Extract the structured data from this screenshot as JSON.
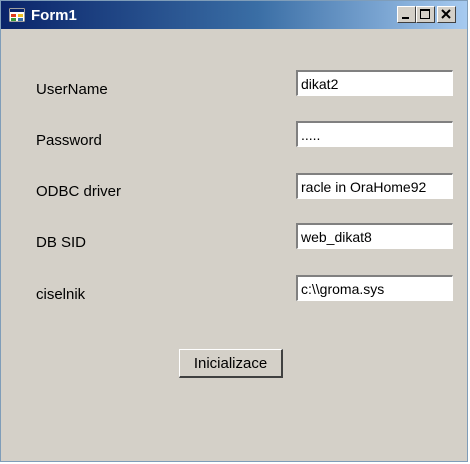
{
  "window": {
    "title": "Form1",
    "icon": "form-app-icon",
    "controls": {
      "minimize": "minimize-icon",
      "maximize": "maximize-icon",
      "close": "close-icon"
    }
  },
  "form": {
    "fields": [
      {
        "label": "UserName",
        "value": "dikat2"
      },
      {
        "label": "Password",
        "value": "....."
      },
      {
        "label": "ODBC driver",
        "value": "racle in OraHome92"
      },
      {
        "label": "DB SID",
        "value": "web_dikat8"
      },
      {
        "label": "ciselnik",
        "value": "c:\\\\groma.sys"
      }
    ],
    "button_label": "Inicializace"
  },
  "colors": {
    "face": "#d4d0c8",
    "title_start": "#0a246a",
    "title_end": "#a6caf0"
  }
}
